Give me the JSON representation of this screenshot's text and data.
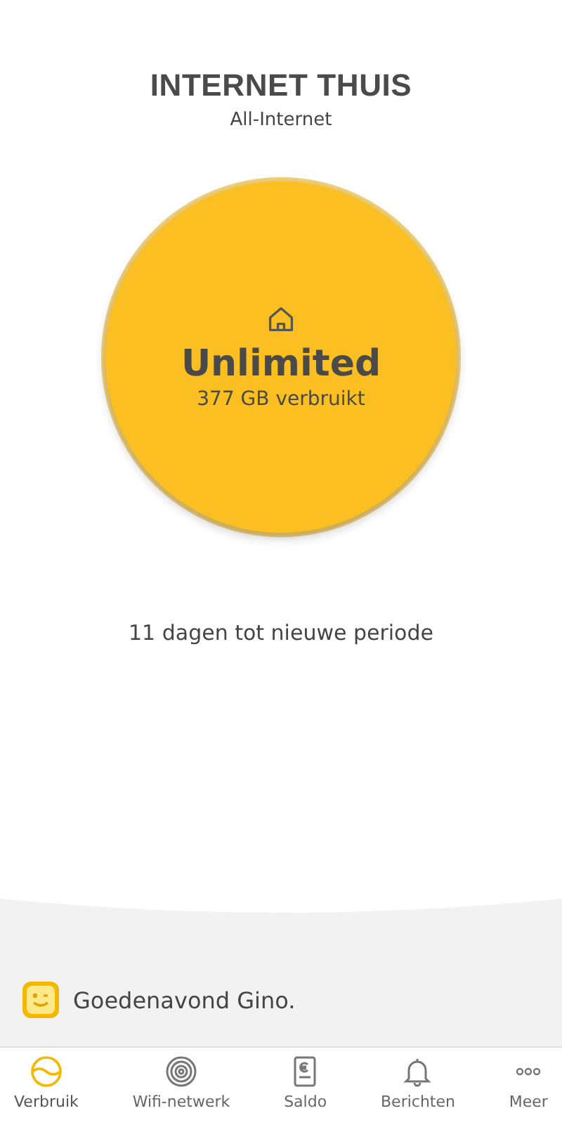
{
  "header": {
    "title": "INTERNET THUIS",
    "subtitle": "All-Internet"
  },
  "usage": {
    "label": "Unlimited",
    "reading": "377 GB verbruikt"
  },
  "period_text": "11 dagen tot nieuwe periode",
  "greeting": "Goedenavond Gino.",
  "nav": [
    {
      "label": "Verbruik",
      "kind": "usage",
      "selected": true
    },
    {
      "label": "Wifi-netwerk",
      "kind": "wifi",
      "selected": false
    },
    {
      "label": "Saldo",
      "kind": "balance",
      "selected": false
    },
    {
      "label": "Berichten",
      "kind": "bell",
      "selected": false
    },
    {
      "label": "Meer",
      "kind": "more",
      "selected": false
    }
  ]
}
